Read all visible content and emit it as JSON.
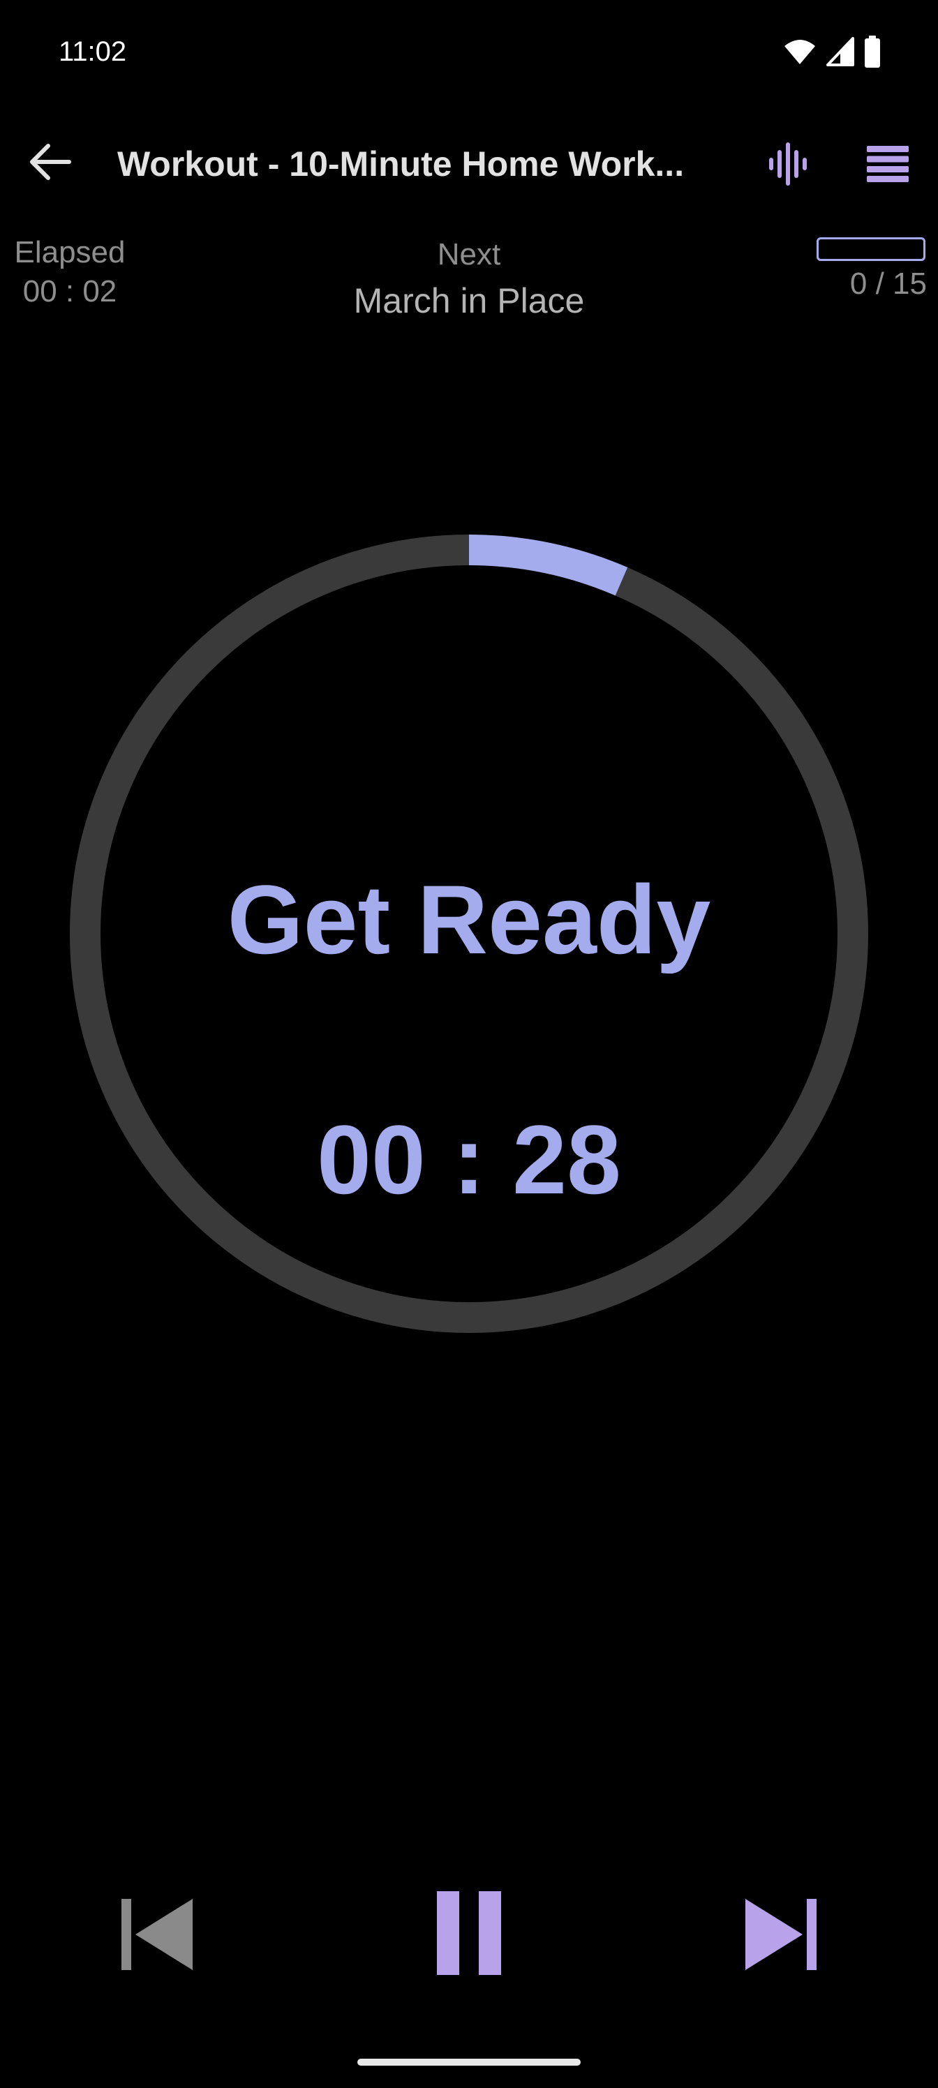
{
  "status_bar": {
    "time": "11:02",
    "icons": [
      "wifi-icon",
      "cell-signal-icon",
      "battery-icon"
    ]
  },
  "app_bar": {
    "back_icon": "arrow-back-icon",
    "title": "Workout - 10-Minute Home Work...",
    "voice_icon": "voice-waveform-icon",
    "menu_icon": "menu-list-icon"
  },
  "info": {
    "elapsed_label": "Elapsed",
    "elapsed_value": "00 : 02",
    "next_label": "Next",
    "next_value": "March in Place",
    "progress_text": "0 / 15",
    "progress_fraction": 0.0
  },
  "timer": {
    "phase": "Get Ready",
    "countdown": "00 : 28",
    "ring_progress_fraction": 0.065
  },
  "controls": {
    "previous_icon": "skip-previous-icon",
    "pause_icon": "pause-icon",
    "next_icon": "skip-next-icon"
  },
  "colors": {
    "accent": "#a5acee",
    "control_accent": "#b8a3ea",
    "ring_track": "#3a3a3a",
    "disabled": "#8a8a8a",
    "background": "#000000"
  }
}
